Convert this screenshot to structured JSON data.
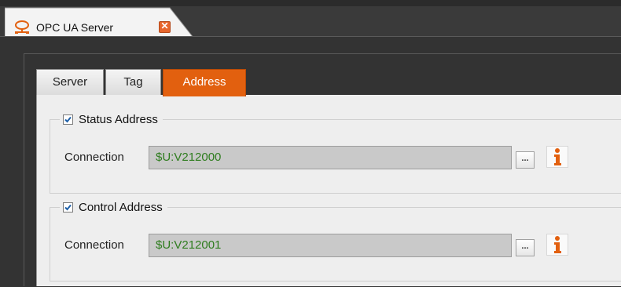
{
  "window": {
    "tab_title": "OPC UA Server",
    "tab_icon": "network-icon",
    "close_glyph": "✕",
    "accent_color": "#e2600f"
  },
  "tabs": [
    {
      "label": "Server",
      "active": false
    },
    {
      "label": "Tag",
      "active": false
    },
    {
      "label": "Address",
      "active": true
    }
  ],
  "groups": [
    {
      "title": "Status Address",
      "checked": true,
      "connection_label": "Connection",
      "connection_value": "$U:V212000",
      "browse_label": "...",
      "info_icon": "info-icon"
    },
    {
      "title": "Control Address",
      "checked": true,
      "connection_label": "Connection",
      "connection_value": "$U:V212001",
      "browse_label": "...",
      "info_icon": "info-icon"
    }
  ]
}
